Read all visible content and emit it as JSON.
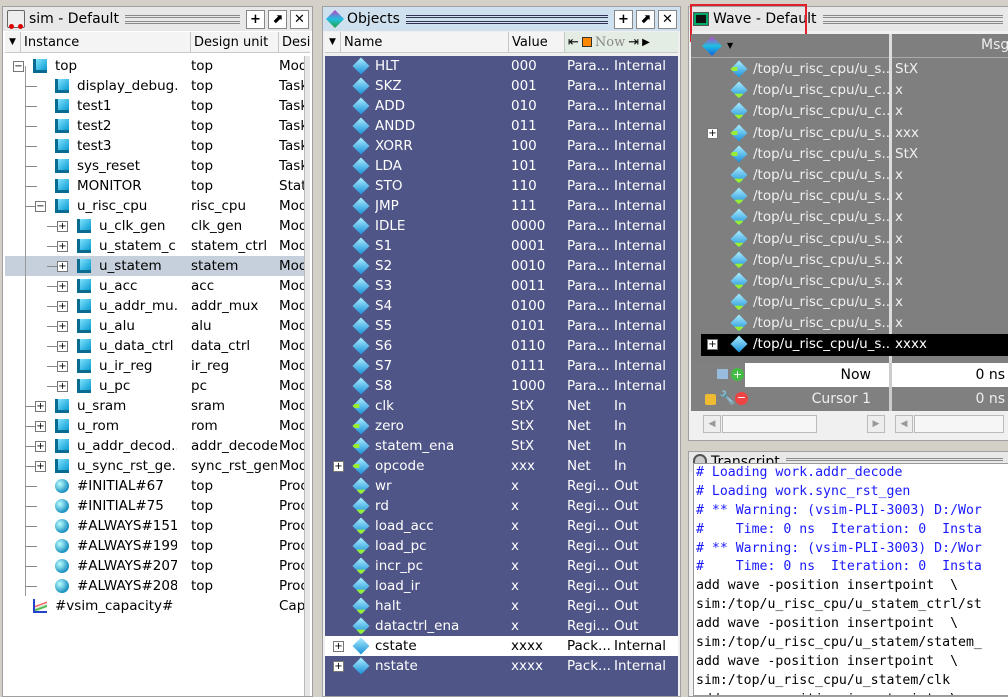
{
  "sim": {
    "title": "sim - Default",
    "columns": [
      "Instance",
      "Design unit",
      "Design"
    ],
    "rows": [
      {
        "name": "top",
        "unit": "top",
        "type": "Modu",
        "level": 0,
        "icon": "module",
        "expander": "-"
      },
      {
        "name": "display_debug...",
        "unit": "top",
        "type": "Task",
        "level": 1,
        "icon": "module"
      },
      {
        "name": "test1",
        "unit": "top",
        "type": "Task",
        "level": 1,
        "icon": "module"
      },
      {
        "name": "test2",
        "unit": "top",
        "type": "Task",
        "level": 1,
        "icon": "module"
      },
      {
        "name": "test3",
        "unit": "top",
        "type": "Task",
        "level": 1,
        "icon": "module"
      },
      {
        "name": "sys_reset",
        "unit": "top",
        "type": "Task",
        "level": 1,
        "icon": "module"
      },
      {
        "name": "MONITOR",
        "unit": "top",
        "type": "State",
        "level": 1,
        "icon": "module"
      },
      {
        "name": "u_risc_cpu",
        "unit": "risc_cpu",
        "type": "Modu",
        "level": 1,
        "icon": "module",
        "expander": "-"
      },
      {
        "name": "u_clk_gen",
        "unit": "clk_gen",
        "type": "Modu",
        "level": 2,
        "icon": "module",
        "expander": "+"
      },
      {
        "name": "u_statem_c...",
        "unit": "statem_ctrl",
        "type": "Modu",
        "level": 2,
        "icon": "module",
        "expander": "+"
      },
      {
        "name": "u_statem",
        "unit": "statem",
        "type": "Modu",
        "level": 2,
        "icon": "module",
        "expander": "+",
        "selected": true
      },
      {
        "name": "u_acc",
        "unit": "acc",
        "type": "Modu",
        "level": 2,
        "icon": "module",
        "expander": "+"
      },
      {
        "name": "u_addr_mu...",
        "unit": "addr_mux",
        "type": "Modu",
        "level": 2,
        "icon": "module",
        "expander": "+"
      },
      {
        "name": "u_alu",
        "unit": "alu",
        "type": "Modu",
        "level": 2,
        "icon": "module",
        "expander": "+"
      },
      {
        "name": "u_data_ctrl",
        "unit": "data_ctrl",
        "type": "Modu",
        "level": 2,
        "icon": "module",
        "expander": "+"
      },
      {
        "name": "u_ir_reg",
        "unit": "ir_reg",
        "type": "Modu",
        "level": 2,
        "icon": "module",
        "expander": "+"
      },
      {
        "name": "u_pc",
        "unit": "pc",
        "type": "Modu",
        "level": 2,
        "icon": "module",
        "expander": "+"
      },
      {
        "name": "u_sram",
        "unit": "sram",
        "type": "Modu",
        "level": 1,
        "icon": "module",
        "expander": "+"
      },
      {
        "name": "u_rom",
        "unit": "rom",
        "type": "Modu",
        "level": 1,
        "icon": "module",
        "expander": "+"
      },
      {
        "name": "u_addr_decod...",
        "unit": "addr_decode",
        "type": "Modu",
        "level": 1,
        "icon": "module",
        "expander": "+"
      },
      {
        "name": "u_sync_rst_ge...",
        "unit": "sync_rst_gen",
        "type": "Modu",
        "level": 1,
        "icon": "module",
        "expander": "+"
      },
      {
        "name": "#INITIAL#67",
        "unit": "top",
        "type": "Proce",
        "level": 1,
        "icon": "process"
      },
      {
        "name": "#INITIAL#75",
        "unit": "top",
        "type": "Proce",
        "level": 1,
        "icon": "process"
      },
      {
        "name": "#ALWAYS#151...",
        "unit": "top",
        "type": "Proce",
        "level": 1,
        "icon": "process"
      },
      {
        "name": "#ALWAYS#199...",
        "unit": "top",
        "type": "Proce",
        "level": 1,
        "icon": "process"
      },
      {
        "name": "#ALWAYS#207...",
        "unit": "top",
        "type": "Proce",
        "level": 1,
        "icon": "process"
      },
      {
        "name": "#ALWAYS#208...",
        "unit": "top",
        "type": "Proce",
        "level": 1,
        "icon": "process"
      },
      {
        "name": "#vsim_capacity#",
        "unit": "",
        "type": "Capac",
        "level": 0,
        "icon": "capacity"
      }
    ]
  },
  "objects": {
    "title": "Objects",
    "columns": [
      "Name",
      "Value"
    ],
    "now_label": "Now",
    "rows": [
      {
        "name": "HLT",
        "value": "000",
        "kind": "Para...",
        "mode": "Internal",
        "icon": "param"
      },
      {
        "name": "SKZ",
        "value": "001",
        "kind": "Para...",
        "mode": "Internal",
        "icon": "param"
      },
      {
        "name": "ADD",
        "value": "010",
        "kind": "Para...",
        "mode": "Internal",
        "icon": "param"
      },
      {
        "name": "ANDD",
        "value": "011",
        "kind": "Para...",
        "mode": "Internal",
        "icon": "param"
      },
      {
        "name": "XORR",
        "value": "100",
        "kind": "Para...",
        "mode": "Internal",
        "icon": "param"
      },
      {
        "name": "LDA",
        "value": "101",
        "kind": "Para...",
        "mode": "Internal",
        "icon": "param"
      },
      {
        "name": "STO",
        "value": "110",
        "kind": "Para...",
        "mode": "Internal",
        "icon": "param"
      },
      {
        "name": "JMP",
        "value": "111",
        "kind": "Para...",
        "mode": "Internal",
        "icon": "param"
      },
      {
        "name": "IDLE",
        "value": "0000",
        "kind": "Para...",
        "mode": "Internal",
        "icon": "param"
      },
      {
        "name": "S1",
        "value": "0001",
        "kind": "Para...",
        "mode": "Internal",
        "icon": "param"
      },
      {
        "name": "S2",
        "value": "0010",
        "kind": "Para...",
        "mode": "Internal",
        "icon": "param"
      },
      {
        "name": "S3",
        "value": "0011",
        "kind": "Para...",
        "mode": "Internal",
        "icon": "param"
      },
      {
        "name": "S4",
        "value": "0100",
        "kind": "Para...",
        "mode": "Internal",
        "icon": "param"
      },
      {
        "name": "S5",
        "value": "0101",
        "kind": "Para...",
        "mode": "Internal",
        "icon": "param"
      },
      {
        "name": "S6",
        "value": "0110",
        "kind": "Para...",
        "mode": "Internal",
        "icon": "param"
      },
      {
        "name": "S7",
        "value": "0111",
        "kind": "Para...",
        "mode": "Internal",
        "icon": "param"
      },
      {
        "name": "S8",
        "value": "1000",
        "kind": "Para...",
        "mode": "Internal",
        "icon": "param"
      },
      {
        "name": "clk",
        "value": "StX",
        "kind": "Net",
        "mode": "In",
        "icon": "input"
      },
      {
        "name": "zero",
        "value": "StX",
        "kind": "Net",
        "mode": "In",
        "icon": "input"
      },
      {
        "name": "statem_ena",
        "value": "StX",
        "kind": "Net",
        "mode": "In",
        "icon": "input"
      },
      {
        "name": "opcode",
        "value": "xxx",
        "kind": "Net",
        "mode": "In",
        "icon": "input",
        "expander": "+"
      },
      {
        "name": "wr",
        "value": "x",
        "kind": "Regi...",
        "mode": "Out",
        "icon": "output"
      },
      {
        "name": "rd",
        "value": "x",
        "kind": "Regi...",
        "mode": "Out",
        "icon": "output"
      },
      {
        "name": "load_acc",
        "value": "x",
        "kind": "Regi...",
        "mode": "Out",
        "icon": "output"
      },
      {
        "name": "load_pc",
        "value": "x",
        "kind": "Regi...",
        "mode": "Out",
        "icon": "output"
      },
      {
        "name": "incr_pc",
        "value": "x",
        "kind": "Regi...",
        "mode": "Out",
        "icon": "output"
      },
      {
        "name": "load_ir",
        "value": "x",
        "kind": "Regi...",
        "mode": "Out",
        "icon": "output"
      },
      {
        "name": "halt",
        "value": "x",
        "kind": "Regi...",
        "mode": "Out",
        "icon": "output"
      },
      {
        "name": "datactrl_ena",
        "value": "x",
        "kind": "Regi...",
        "mode": "Out",
        "icon": "output"
      },
      {
        "name": "cstate",
        "value": "xxxx",
        "kind": "Pack...",
        "mode": "Internal",
        "icon": "param",
        "expander": "+",
        "selected": true
      },
      {
        "name": "nstate",
        "value": "xxxx",
        "kind": "Pack...",
        "mode": "Internal",
        "icon": "param",
        "expander": "+"
      }
    ]
  },
  "wave": {
    "title": "Wave - Default",
    "msgs_label": "Msgs",
    "now_label": "Now",
    "now_value": "0 ns",
    "cursor_label": "Cursor 1",
    "cursor_value": "0 ns",
    "highlight_color": "#e0202a",
    "rows": [
      {
        "path": "/top/u_risc_cpu/u_s...",
        "value": "StX",
        "icon": "input"
      },
      {
        "path": "/top/u_risc_cpu/u_c...",
        "value": "x",
        "icon": "output"
      },
      {
        "path": "/top/u_risc_cpu/u_c...",
        "value": "x",
        "icon": "output"
      },
      {
        "path": "/top/u_risc_cpu/u_s...",
        "value": "xxx",
        "icon": "input",
        "expander": "+"
      },
      {
        "path": "/top/u_risc_cpu/u_s...",
        "value": "StX",
        "icon": "input"
      },
      {
        "path": "/top/u_risc_cpu/u_s...",
        "value": "x",
        "icon": "output"
      },
      {
        "path": "/top/u_risc_cpu/u_s...",
        "value": "x",
        "icon": "output"
      },
      {
        "path": "/top/u_risc_cpu/u_s...",
        "value": "x",
        "icon": "output"
      },
      {
        "path": "/top/u_risc_cpu/u_s...",
        "value": "x",
        "icon": "output"
      },
      {
        "path": "/top/u_risc_cpu/u_s...",
        "value": "x",
        "icon": "output"
      },
      {
        "path": "/top/u_risc_cpu/u_s...",
        "value": "x",
        "icon": "output"
      },
      {
        "path": "/top/u_risc_cpu/u_s...",
        "value": "x",
        "icon": "output"
      },
      {
        "path": "/top/u_risc_cpu/u_s...",
        "value": "x",
        "icon": "output"
      },
      {
        "path": "/top/u_risc_cpu/u_s...",
        "value": "xxxx",
        "icon": "param",
        "expander": "+",
        "selected": true
      }
    ]
  },
  "transcript": {
    "title": "Transcript",
    "lines": [
      {
        "text": "# Loading work.addr_decode",
        "color": "#1a1aff"
      },
      {
        "text": "# Loading work.sync_rst_gen",
        "color": "#1a1aff"
      },
      {
        "text": "# ** Warning: (vsim-PLI-3003) D:/Wor",
        "color": "#1a1aff"
      },
      {
        "text": "#    Time: 0 ns  Iteration: 0  Insta",
        "color": "#1a1aff"
      },
      {
        "text": "# ** Warning: (vsim-PLI-3003) D:/Wor",
        "color": "#1a1aff"
      },
      {
        "text": "#    Time: 0 ns  Iteration: 0  Insta",
        "color": "#1a1aff"
      },
      {
        "text": "add wave -position insertpoint  \\",
        "color": "#000000"
      },
      {
        "text": "sim:/top/u_risc_cpu/u_statem_ctrl/st",
        "color": "#000000"
      },
      {
        "text": "add wave -position insertpoint  \\",
        "color": "#000000"
      },
      {
        "text": "sim:/top/u_risc_cpu/u_statem/statem_",
        "color": "#000000"
      },
      {
        "text": "add wave -position insertpoint  \\",
        "color": "#000000"
      },
      {
        "text": "sim:/top/u_risc_cpu/u_statem/clk",
        "color": "#000000"
      },
      {
        "text": "add wave -position insertpoint  \\",
        "color": "#000000"
      }
    ]
  }
}
